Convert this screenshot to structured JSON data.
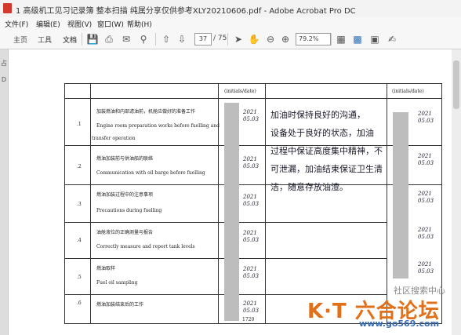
{
  "window": {
    "title": "1 高级机工见习记录簿  整本扫描  纯属分享仅供参考XLY20210606.pdf - Adobe Acrobat Pro DC"
  },
  "menu": {
    "items": [
      "文件(F)",
      "编辑(E)",
      "视图(V)",
      "窗口(W)",
      "帮助(H)"
    ]
  },
  "toolbar": {
    "tabs": [
      "主页",
      "工具",
      "文档"
    ],
    "page_current": "37",
    "page_total": "/ 75",
    "zoom": "79.2%"
  },
  "left_panel": {
    "tabs": [
      "占",
      "D"
    ]
  },
  "document": {
    "header_initials": "(initials/date)",
    "header_initials_right": "(initials/date)",
    "rows": [
      {
        "num": ".1",
        "zh": "加装燃油和内部滤油前，机舱应做好的准备工作",
        "en1": "Engine room preparation works before fuelling and",
        "en2": "transfer operation",
        "date": "2021\n05.03"
      },
      {
        "num": ".2",
        "zh": "燃油加装前与供油船的联络",
        "en1": "Communication with oil barge before fuelling",
        "en2": "",
        "date": "2021\n05.03"
      },
      {
        "num": ".3",
        "zh": "燃油加装过程中的注意事项",
        "en1": "Precautions during fuelling",
        "en2": "",
        "date": "2021\n05.03"
      },
      {
        "num": ".4",
        "zh": "油舱液位的正确测量与报告",
        "en1": "Correctly measure and report tank levels",
        "en2": "",
        "date": "2021\n05.03"
      },
      {
        "num": ".5",
        "zh": "燃油取样",
        "en1": "Fuel oil sampling",
        "en2": "",
        "date": "2021\n05.03"
      },
      {
        "num": ".6",
        "zh": "燃油加装结束后的工作",
        "en1": "",
        "en2": "",
        "date": "2021\n05.03"
      }
    ],
    "remarks_lines": [
      "加油时保持良好的沟通，",
      "设备处于良好的状态，加油",
      "过程中保证高度集中精神，不",
      "可泄漏，加油结束保证卫生清",
      "洁，随意存放油渣。"
    ],
    "right_dates": [
      "2021\n05.03",
      "2021\n05.03",
      "2021\n05.03",
      "2021\n05.03",
      "2021\n05.03"
    ],
    "page_number": "1720"
  },
  "watermark": {
    "line1": "社区搜索中心",
    "logo": "K·T 六合论坛",
    "url": "www.go569.com"
  }
}
